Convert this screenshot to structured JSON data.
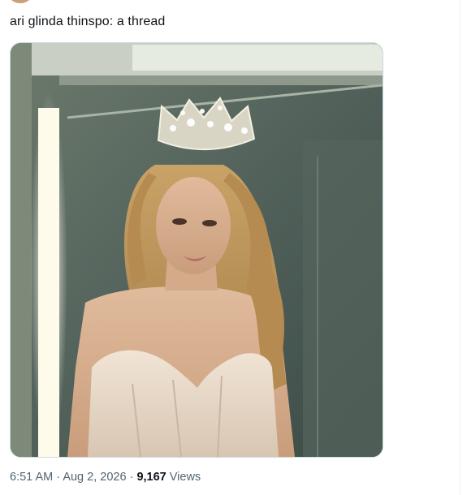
{
  "tweet": {
    "text": "ari glinda thinspo: a thread",
    "time": "6:51 AM",
    "separator_1": "·",
    "date": "Aug 2, 2026",
    "separator_2": "·",
    "views_count": "9,167",
    "views_label": "Views"
  },
  "media": {
    "alt": "Photo of a woman with long wavy blonde hair wearing a sparkling crown and a white strapless corset dress"
  }
}
